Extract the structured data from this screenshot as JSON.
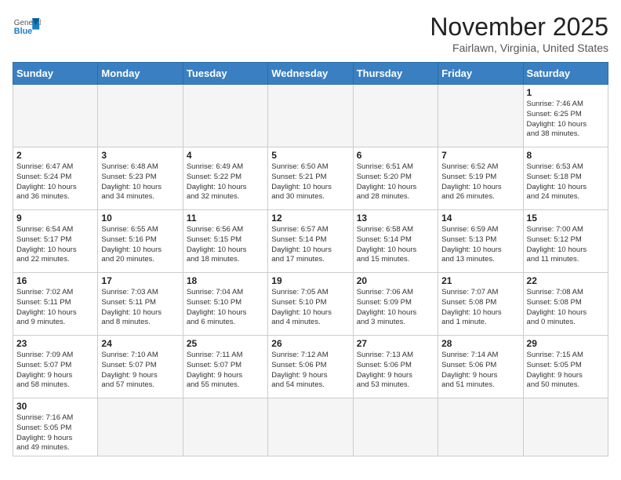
{
  "header": {
    "logo_general": "General",
    "logo_blue": "Blue",
    "month_title": "November 2025",
    "location": "Fairlawn, Virginia, United States"
  },
  "weekdays": [
    "Sunday",
    "Monday",
    "Tuesday",
    "Wednesday",
    "Thursday",
    "Friday",
    "Saturday"
  ],
  "weeks": [
    [
      {
        "day": "",
        "info": ""
      },
      {
        "day": "",
        "info": ""
      },
      {
        "day": "",
        "info": ""
      },
      {
        "day": "",
        "info": ""
      },
      {
        "day": "",
        "info": ""
      },
      {
        "day": "",
        "info": ""
      },
      {
        "day": "1",
        "info": "Sunrise: 7:46 AM\nSunset: 6:25 PM\nDaylight: 10 hours\nand 38 minutes."
      }
    ],
    [
      {
        "day": "2",
        "info": "Sunrise: 6:47 AM\nSunset: 5:24 PM\nDaylight: 10 hours\nand 36 minutes."
      },
      {
        "day": "3",
        "info": "Sunrise: 6:48 AM\nSunset: 5:23 PM\nDaylight: 10 hours\nand 34 minutes."
      },
      {
        "day": "4",
        "info": "Sunrise: 6:49 AM\nSunset: 5:22 PM\nDaylight: 10 hours\nand 32 minutes."
      },
      {
        "day": "5",
        "info": "Sunrise: 6:50 AM\nSunset: 5:21 PM\nDaylight: 10 hours\nand 30 minutes."
      },
      {
        "day": "6",
        "info": "Sunrise: 6:51 AM\nSunset: 5:20 PM\nDaylight: 10 hours\nand 28 minutes."
      },
      {
        "day": "7",
        "info": "Sunrise: 6:52 AM\nSunset: 5:19 PM\nDaylight: 10 hours\nand 26 minutes."
      },
      {
        "day": "8",
        "info": "Sunrise: 6:53 AM\nSunset: 5:18 PM\nDaylight: 10 hours\nand 24 minutes."
      }
    ],
    [
      {
        "day": "9",
        "info": "Sunrise: 6:54 AM\nSunset: 5:17 PM\nDaylight: 10 hours\nand 22 minutes."
      },
      {
        "day": "10",
        "info": "Sunrise: 6:55 AM\nSunset: 5:16 PM\nDaylight: 10 hours\nand 20 minutes."
      },
      {
        "day": "11",
        "info": "Sunrise: 6:56 AM\nSunset: 5:15 PM\nDaylight: 10 hours\nand 18 minutes."
      },
      {
        "day": "12",
        "info": "Sunrise: 6:57 AM\nSunset: 5:14 PM\nDaylight: 10 hours\nand 17 minutes."
      },
      {
        "day": "13",
        "info": "Sunrise: 6:58 AM\nSunset: 5:14 PM\nDaylight: 10 hours\nand 15 minutes."
      },
      {
        "day": "14",
        "info": "Sunrise: 6:59 AM\nSunset: 5:13 PM\nDaylight: 10 hours\nand 13 minutes."
      },
      {
        "day": "15",
        "info": "Sunrise: 7:00 AM\nSunset: 5:12 PM\nDaylight: 10 hours\nand 11 minutes."
      }
    ],
    [
      {
        "day": "16",
        "info": "Sunrise: 7:02 AM\nSunset: 5:11 PM\nDaylight: 10 hours\nand 9 minutes."
      },
      {
        "day": "17",
        "info": "Sunrise: 7:03 AM\nSunset: 5:11 PM\nDaylight: 10 hours\nand 8 minutes."
      },
      {
        "day": "18",
        "info": "Sunrise: 7:04 AM\nSunset: 5:10 PM\nDaylight: 10 hours\nand 6 minutes."
      },
      {
        "day": "19",
        "info": "Sunrise: 7:05 AM\nSunset: 5:10 PM\nDaylight: 10 hours\nand 4 minutes."
      },
      {
        "day": "20",
        "info": "Sunrise: 7:06 AM\nSunset: 5:09 PM\nDaylight: 10 hours\nand 3 minutes."
      },
      {
        "day": "21",
        "info": "Sunrise: 7:07 AM\nSunset: 5:08 PM\nDaylight: 10 hours\nand 1 minute."
      },
      {
        "day": "22",
        "info": "Sunrise: 7:08 AM\nSunset: 5:08 PM\nDaylight: 10 hours\nand 0 minutes."
      }
    ],
    [
      {
        "day": "23",
        "info": "Sunrise: 7:09 AM\nSunset: 5:07 PM\nDaylight: 9 hours\nand 58 minutes."
      },
      {
        "day": "24",
        "info": "Sunrise: 7:10 AM\nSunset: 5:07 PM\nDaylight: 9 hours\nand 57 minutes."
      },
      {
        "day": "25",
        "info": "Sunrise: 7:11 AM\nSunset: 5:07 PM\nDaylight: 9 hours\nand 55 minutes."
      },
      {
        "day": "26",
        "info": "Sunrise: 7:12 AM\nSunset: 5:06 PM\nDaylight: 9 hours\nand 54 minutes."
      },
      {
        "day": "27",
        "info": "Sunrise: 7:13 AM\nSunset: 5:06 PM\nDaylight: 9 hours\nand 53 minutes."
      },
      {
        "day": "28",
        "info": "Sunrise: 7:14 AM\nSunset: 5:06 PM\nDaylight: 9 hours\nand 51 minutes."
      },
      {
        "day": "29",
        "info": "Sunrise: 7:15 AM\nSunset: 5:05 PM\nDaylight: 9 hours\nand 50 minutes."
      }
    ],
    [
      {
        "day": "30",
        "info": "Sunrise: 7:16 AM\nSunset: 5:05 PM\nDaylight: 9 hours\nand 49 minutes."
      },
      {
        "day": "",
        "info": ""
      },
      {
        "day": "",
        "info": ""
      },
      {
        "day": "",
        "info": ""
      },
      {
        "day": "",
        "info": ""
      },
      {
        "day": "",
        "info": ""
      },
      {
        "day": "",
        "info": ""
      }
    ]
  ]
}
